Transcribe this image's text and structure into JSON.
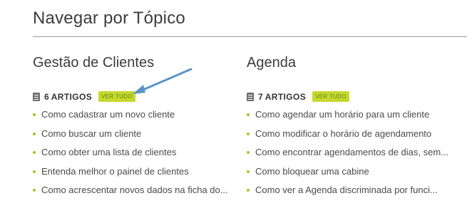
{
  "page_title": "Navegar por Tópico",
  "sections": [
    {
      "title": "Gestão de Clientes",
      "count": "6",
      "count_label": "ARTIGOS",
      "see_all": "VER TUDO",
      "articles": [
        "Como cadastrar um novo cliente",
        "Como buscar um cliente",
        "Como obter uma lista de clientes",
        "Entenda melhor o painel de clientes",
        "Como acrescentar novos dados na ficha do..."
      ]
    },
    {
      "title": "Agenda",
      "count": "7",
      "count_label": "ARTIGOS",
      "see_all": "VER TUDO",
      "articles": [
        "Como agendar um horário para um cliente",
        "Como modificar o horário de agendamento",
        "Como encontrar agendamentos de dias, sem...",
        "Como bloquear uma cabine",
        "Como ver a Agenda discriminada por funci..."
      ]
    }
  ],
  "colors": {
    "accent_green": "#c4d92e",
    "bullet_green": "#a8c426",
    "annotation_arrow": "#5b93c7"
  },
  "icons": {
    "article_count": "document-list-icon",
    "annotation": "arrow-annotation"
  }
}
